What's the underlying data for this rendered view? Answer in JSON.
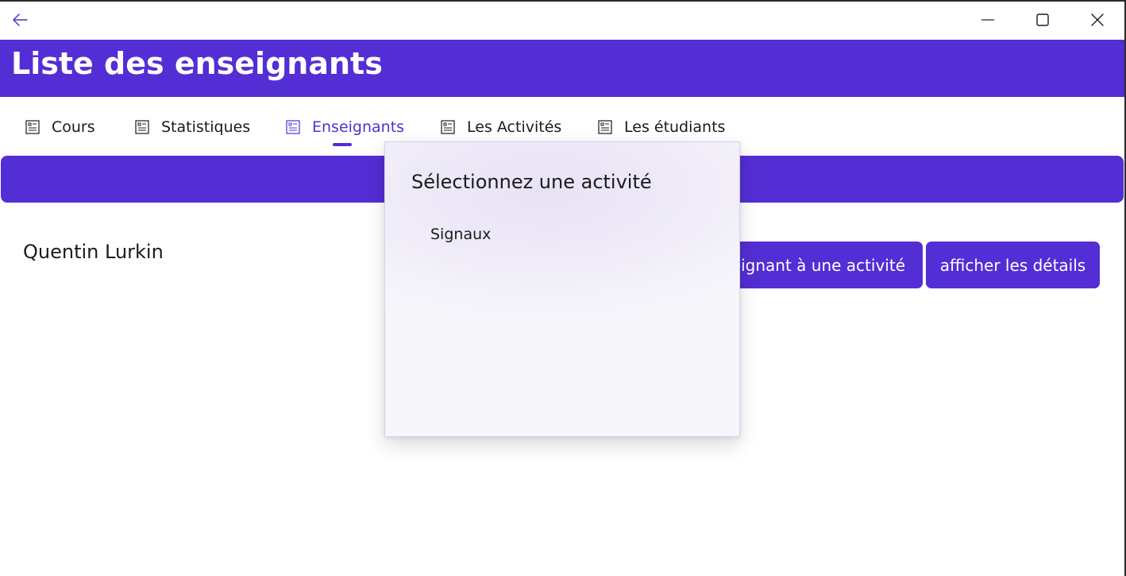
{
  "window": {
    "caption_buttons": [
      "minimize-icon",
      "maximize-icon",
      "close-icon"
    ]
  },
  "header": {
    "title": "Liste des enseignants",
    "color": "#532ed4"
  },
  "tabs": [
    {
      "label": "Cours",
      "icon": "document-list-icon",
      "active": false
    },
    {
      "label": "Statistiques",
      "icon": "document-list-icon",
      "active": false
    },
    {
      "label": "Enseignants",
      "icon": "document-list-icon",
      "active": true
    },
    {
      "label": "Les Activités",
      "icon": "document-list-icon",
      "active": false
    },
    {
      "label": "Les étudiants",
      "icon": "document-list-icon",
      "active": false
    }
  ],
  "content": {
    "teacher_name": "Quentin Lurkin",
    "assign_button_label": "eignant à une activité",
    "details_button_label": "afficher les détails"
  },
  "flyout": {
    "title": "Sélectionnez une activité",
    "items": [
      "Signaux"
    ]
  },
  "colors": {
    "accent": "#532ed4",
    "text": "#1b1b1b",
    "background": "#ffffff"
  }
}
